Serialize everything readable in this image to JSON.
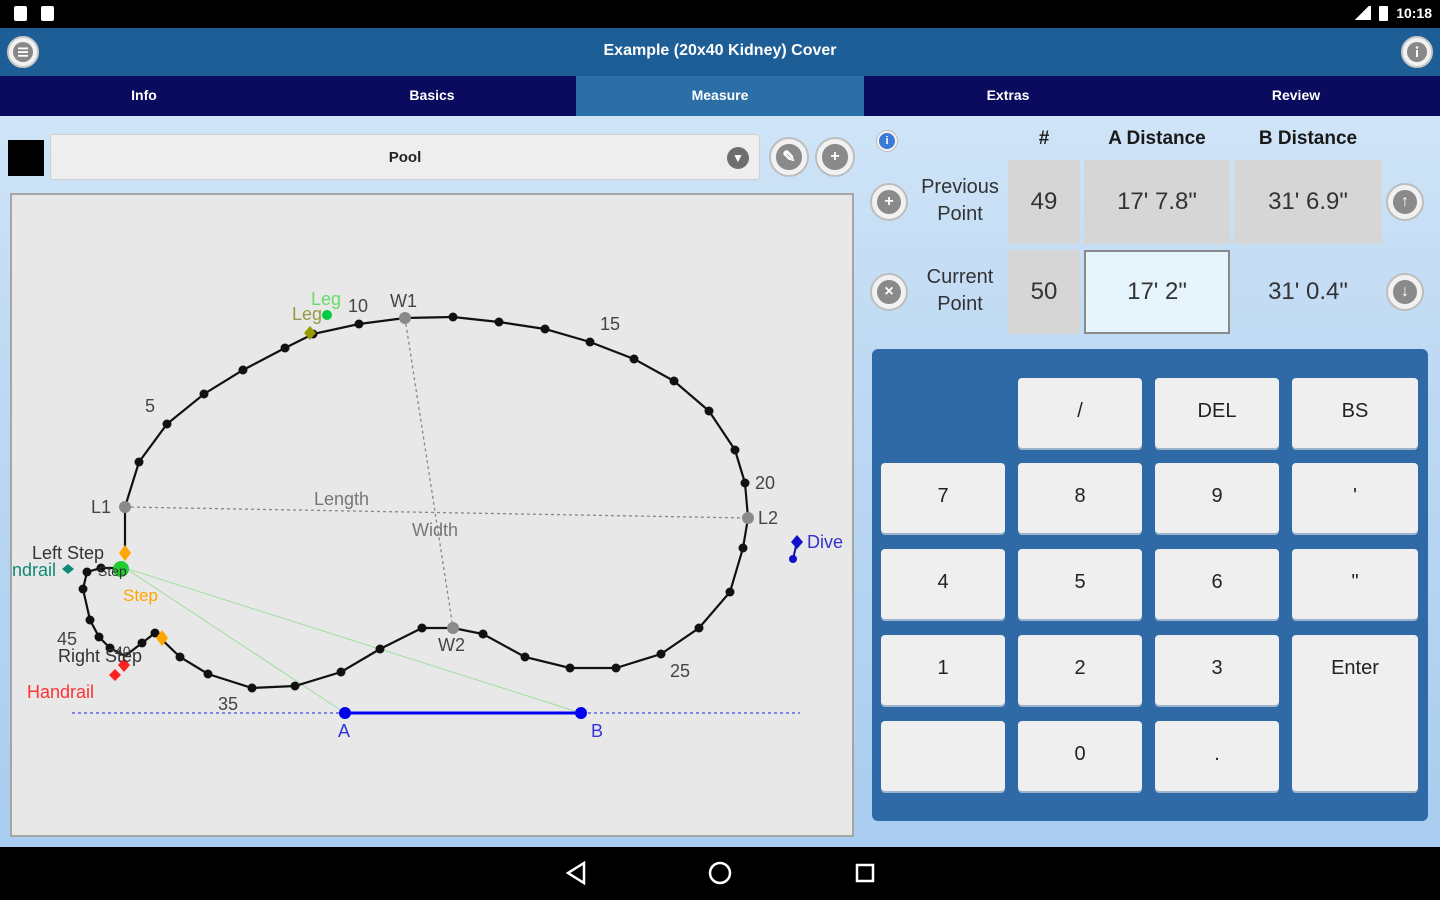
{
  "status": {
    "time": "10:18"
  },
  "appbar": {
    "title": "Example (20x40 Kidney) Cover"
  },
  "tabs": [
    {
      "label": "Info"
    },
    {
      "label": "Basics"
    },
    {
      "label": "Measure",
      "active": true
    },
    {
      "label": "Extras"
    },
    {
      "label": "Review"
    }
  ],
  "shape_selector": {
    "value": "Pool"
  },
  "drawing": {
    "labels": {
      "leg_a": "Leg",
      "leg_b": "Leg",
      "n10": "10",
      "w1": "W1",
      "n15": "15",
      "n5": "5",
      "n20": "20",
      "l1": "L1",
      "length": "Length",
      "l2": "L2",
      "width": "Width",
      "dive": "Dive",
      "left_step": "Left Step",
      "handrail_left": "ndrail",
      "step_small": "Step",
      "step": "Step",
      "n45": "45",
      "right_step": "Right Step",
      "n40": "40",
      "w2": "W2",
      "n25": "25",
      "handrail": "Handrail",
      "n35": "35",
      "a": "A",
      "b": "B"
    }
  },
  "table": {
    "headers": {
      "num": "#",
      "a": "A Distance",
      "b": "B Distance"
    },
    "rows": [
      {
        "label_1": "Previous",
        "label_2": "Point",
        "num": "49",
        "a": "17' 7.8\"",
        "b": "31' 6.9\""
      },
      {
        "label_1": "Current",
        "label_2": "Point",
        "num": "50",
        "a": "17' 2\"",
        "b": "31' 0.4\""
      }
    ]
  },
  "keypad": {
    "slash": "/",
    "del": "DEL",
    "bs": "BS",
    "k7": "7",
    "k8": "8",
    "k9": "9",
    "feet": "'",
    "k4": "4",
    "k5": "5",
    "k6": "6",
    "inches": "\"",
    "k1": "1",
    "k2": "2",
    "k3": "3",
    "enter": "Enter",
    "blank": "",
    "k0": "0",
    "dot": "."
  },
  "colors": {
    "appbar": "#1e5e96",
    "tabbar": "#0a0a5e",
    "tab_active": "#2c6ea6",
    "keypad": "#2f6aa6",
    "measure_line": "#0000ee",
    "handrail": "#ff2020",
    "step": "#ffa500",
    "leg": "#00dd44",
    "dive": "#2222cc"
  }
}
